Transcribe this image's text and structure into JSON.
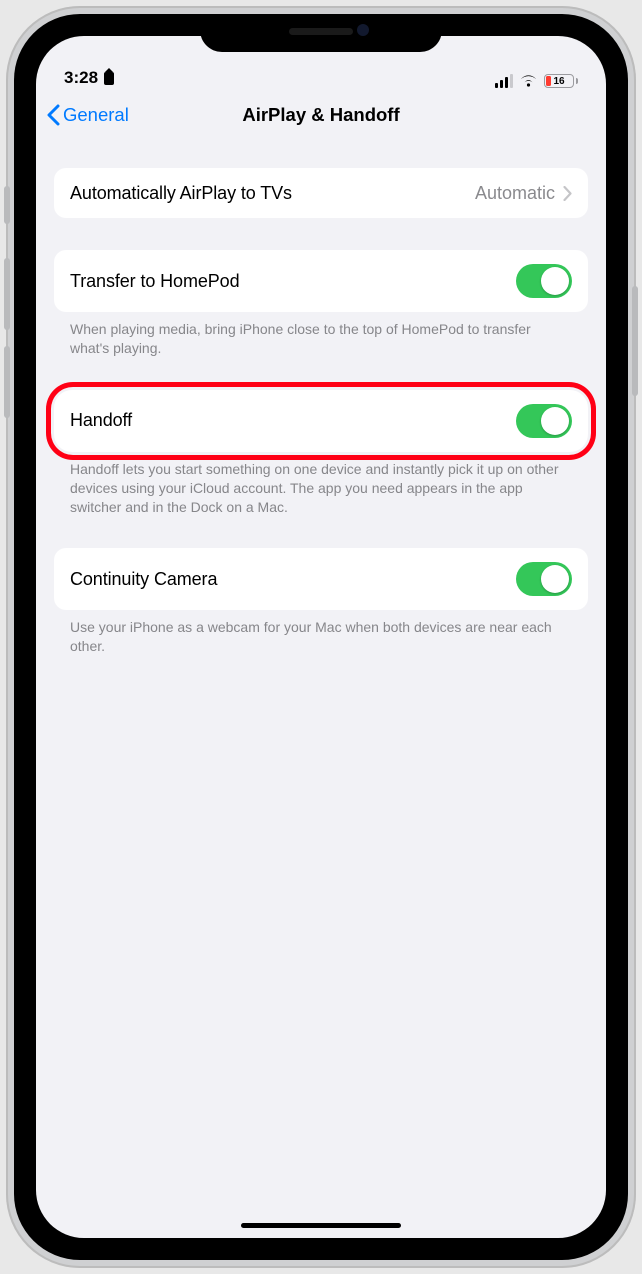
{
  "status": {
    "time": "3:28",
    "battery_pct": "16"
  },
  "nav": {
    "back_label": "General",
    "title": "AirPlay & Handoff"
  },
  "rows": {
    "auto_airplay": {
      "label": "Automatically AirPlay to TVs",
      "value": "Automatic"
    },
    "transfer": {
      "label": "Transfer to HomePod"
    },
    "transfer_footer": "When playing media, bring iPhone close to the top of HomePod to transfer what's playing.",
    "handoff": {
      "label": "Handoff"
    },
    "handoff_footer": "Handoff lets you start something on one device and instantly pick it up on other devices using your iCloud account. The app you need appears in the app switcher and in the Dock on a Mac.",
    "continuity": {
      "label": "Continuity Camera"
    },
    "continuity_footer": "Use your iPhone as a webcam for your Mac when both devices are near each other."
  }
}
